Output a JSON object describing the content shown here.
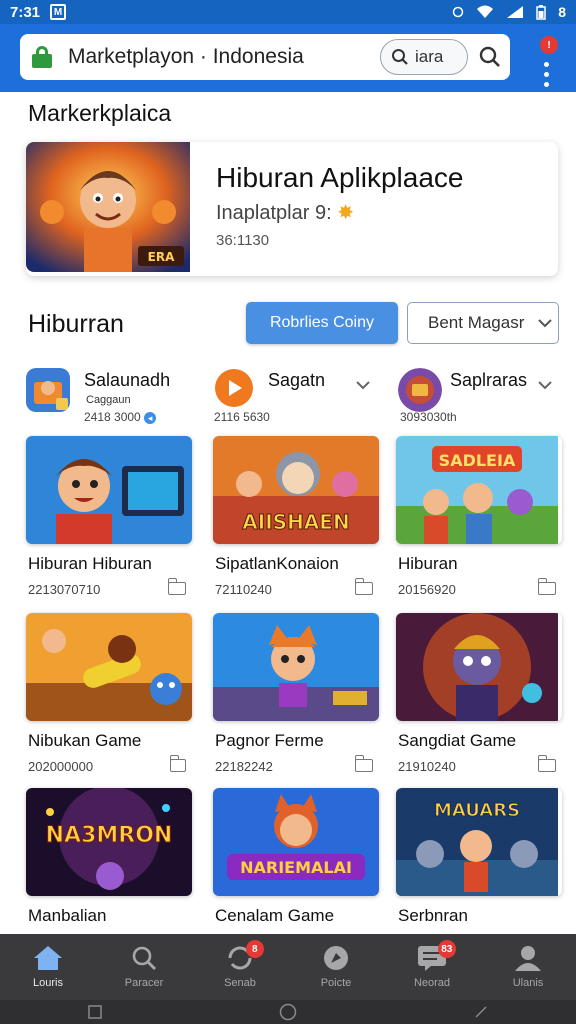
{
  "status_bar": {
    "time": "7:31",
    "battery": "8"
  },
  "browser": {
    "url": "Marketplayon · Indonesia",
    "search_value": "iara"
  },
  "page": {
    "section_heading": "Markerkplaica",
    "featured": {
      "title": "Hiburan Aplikplaace",
      "subtitle": "Inaplatplar 9:",
      "meta": "36:1130"
    },
    "category_heading": "Hiburran",
    "primary_button": "Robrlies Coiny",
    "dropdown_label": "Bent Magasr",
    "categories": [
      {
        "name": "Salaunadh",
        "sub": "Caggaun",
        "meta": "2418 3000"
      },
      {
        "name": "Sagatn",
        "meta": "2116 5630"
      },
      {
        "name": "Saplraras",
        "meta": "3093030th"
      }
    ],
    "cards": [
      {
        "title": "Hiburan Hiburan",
        "meta": "2213070710"
      },
      {
        "title": "SipatlanKonaion",
        "meta": "72110240"
      },
      {
        "title": "Hiburan",
        "meta": "20156920"
      },
      {
        "title": "Nibukan Game",
        "meta": "202000000"
      },
      {
        "title": "Pagnor Ferme",
        "meta": "22182242"
      },
      {
        "title": "Sangdiat Game",
        "meta": "21910240"
      },
      {
        "title": "Manbalian",
        "meta": ""
      },
      {
        "title": "Cenalam Game",
        "meta": ""
      },
      {
        "title": "Serbnran",
        "meta": ""
      }
    ],
    "card_badges": {
      "c3": "SADLEIA",
      "c7": "NA3MRON",
      "c8": "NARIEMALAI",
      "c9": "MAUARS",
      "c2": "AIISHAEN"
    }
  },
  "bottom_nav": [
    {
      "label": "Louris",
      "icon": "home-icon",
      "active": true
    },
    {
      "label": "Paracer",
      "icon": "search-icon"
    },
    {
      "label": "Senab",
      "icon": "refresh-icon",
      "badge": "8"
    },
    {
      "label": "Poicte",
      "icon": "globe-icon"
    },
    {
      "label": "Neorad",
      "icon": "message-icon",
      "badge": "83"
    },
    {
      "label": "Ulanis",
      "icon": "user-icon"
    }
  ],
  "colors": {
    "brand_blue": "#1e6fd9",
    "status_blue": "#1565c0",
    "button_blue": "#4a90e2",
    "nav_bg": "#3a3a3c",
    "badge_red": "#e53935",
    "lock_green": "#2e9a3e"
  }
}
